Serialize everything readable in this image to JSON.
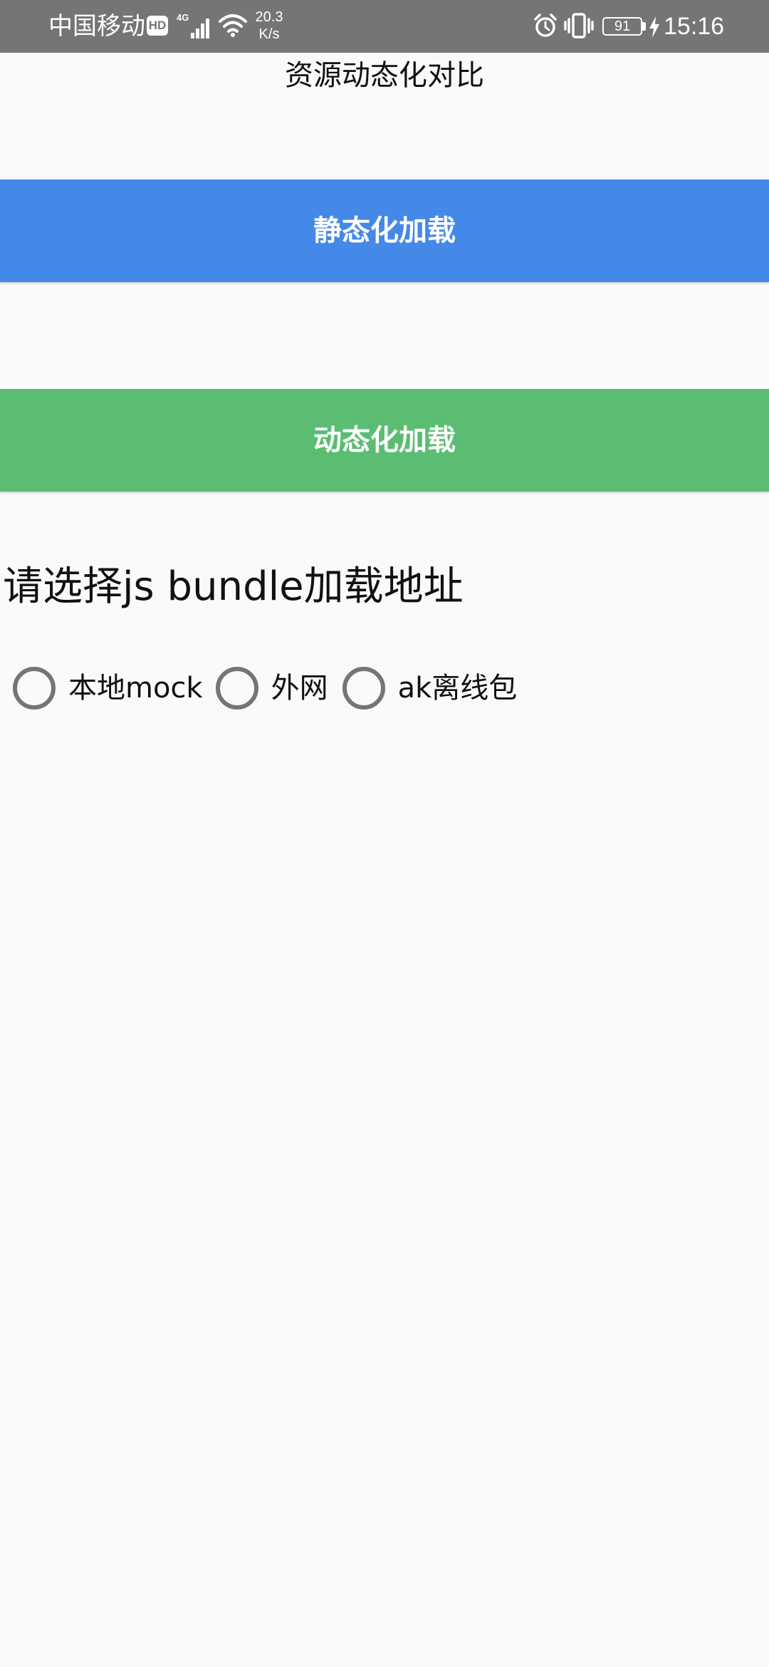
{
  "status_bar": {
    "carrier": "中国移动",
    "hd_badge": "HD",
    "network": "4G",
    "speed_value": "20.3",
    "speed_unit": "K/s",
    "battery": "91",
    "time": "15:16",
    "icons": [
      "hd-icon",
      "signal-icon",
      "wifi-icon",
      "alarm-icon",
      "vibrate-icon",
      "battery-icon",
      "charging-icon"
    ]
  },
  "page": {
    "title": "资源动态化对比"
  },
  "buttons": {
    "static_load": "静态化加载",
    "dynamic_load": "动态化加载"
  },
  "bundle_source": {
    "label": "请选择js bundle加载地址",
    "options": [
      {
        "label": "本地mock",
        "selected": false
      },
      {
        "label": "外网",
        "selected": false
      },
      {
        "label": "ak离线包",
        "selected": false
      }
    ]
  },
  "colors": {
    "status_bar": "#757575",
    "static_button": "#4589e8",
    "dynamic_button": "#5bbd72",
    "background": "#fafafa",
    "radio_border": "#757575"
  }
}
